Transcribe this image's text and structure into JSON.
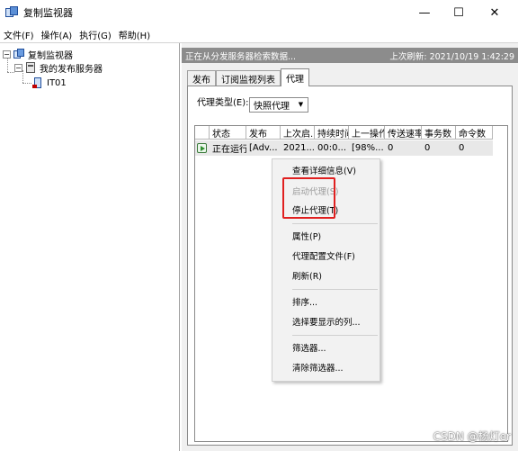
{
  "window": {
    "title": "复制监视器",
    "min_glyph": "—",
    "max_glyph": "☐",
    "close_glyph": "✕"
  },
  "menu": [
    "文件(F)",
    "操作(A)",
    "执行(G)",
    "帮助(H)"
  ],
  "tree": {
    "root": "复制监视器",
    "publisher_group": "我的发布服务器",
    "server": "IT01",
    "toggle_glyph": "−"
  },
  "header": {
    "status": "正在从分发服务器检索数据...",
    "last_refresh": "上次刷新: 2021/10/19 1:42:29"
  },
  "tabs": [
    "发布",
    "订阅监视列表",
    "代理"
  ],
  "agent_type": {
    "label": "代理类型(E):",
    "value": "快照代理",
    "arrow": "▼"
  },
  "grid": {
    "columns": [
      "状态",
      "发布",
      "上次启...",
      "持续时间",
      "上一操作",
      "传送速率",
      "事务数",
      "命令数"
    ],
    "row": [
      "正在运行",
      "[Adv...",
      "2021...",
      "00:0...",
      "[98%...",
      "0",
      "0",
      "0"
    ]
  },
  "context_menu": {
    "view_details": "查看详细信息(V)",
    "start_agent": "启动代理(S)",
    "stop_agent": "停止代理(T)",
    "properties": "属性(P)",
    "agent_profile": "代理配置文件(F)",
    "refresh": "刷新(R)",
    "sort": "排序...",
    "choose_columns": "选择要显示的列...",
    "filter": "筛选器...",
    "clear_filter": "清除筛选器..."
  },
  "watermark": "CSDN @杨灯er",
  "colors": {
    "header_bar": "#8c8c8c",
    "highlight_box": "#e02020",
    "disabled_text": "#9a9a9a"
  }
}
